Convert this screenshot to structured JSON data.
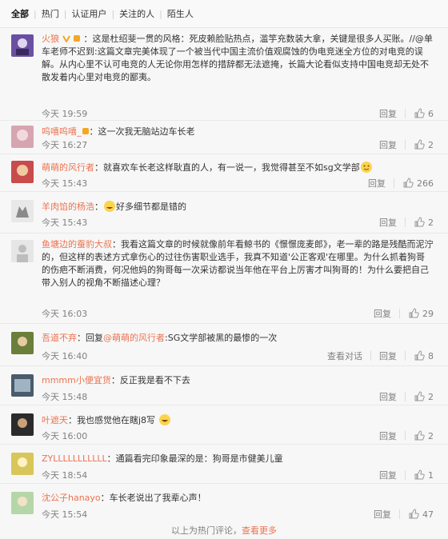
{
  "tabs": [
    "全部",
    "热门",
    "认证用户",
    "关注的人",
    "陌生人"
  ],
  "comments": [
    {
      "name": "火狼",
      "sep": "：",
      "text": "这是杜绍斐一贯的风格：死皮赖脸贴热点，滥竽充数装大拿，关键是很多人买账。//@单车老师不迟到:这篇文章完美体现了一个被当代中国主流价值观腐蚀的伪电竞迷全方位的对电竞的误解。从内心里不认可电竞的人无论你用怎样的措辞都无法遮掩，长篇大论看似支持中国电竞却无处不散发着内心里对电竞的鄙夷。",
      "time": "今天 19:59",
      "reply": "回复",
      "likes": "6"
    },
    {
      "name": "呜嘻呜嘻_",
      "sep": "：",
      "text": "这一次我无脑站边车长老",
      "time": "今天 16:27",
      "reply": "回复",
      "likes": "2"
    },
    {
      "name": "萌萌的风行者",
      "sep": "：",
      "text": "就喜欢车长老这样耿直的人，有一说一，我觉得甚至不如sg文学部",
      "time": "今天 15:43",
      "reply": "回复",
      "likes": "266"
    },
    {
      "name": "羊肉馅的杨浩",
      "sep": "：",
      "text": "好多细节都是错的",
      "time": "今天 15:43",
      "reply": "回复",
      "likes": "2"
    },
    {
      "name": "鱼塘边的蚕豹大叔",
      "sep": "：",
      "text": "我看这篇文章的时候就像前年看鲸书的《憬憬庞麦郎》，老一辈的路是残酷而泥泞的，但这样的表述方式拿伤心的过往伤害职业选手，我真不知道'公正客观'在哪里。为什么抓着狗哥的伤疤不断消费，何况他妈的狗哥每一次采访都说当年他在平台上厉害才叫狗哥的！为什么要把自己带入别人的视角不断描述心理？",
      "time": "今天 16:03",
      "reply": "回复",
      "likes": "29"
    },
    {
      "name": "吾道不弃",
      "sep": "：",
      "text_pre": "回复",
      "mention": "@萌萌的风行者",
      "text": ":SG文学部被黑的最惨的一次",
      "time": "今天 16:40",
      "view": "查看对话",
      "reply": "回复",
      "likes": "8"
    },
    {
      "name": "mmmm小便宜货",
      "sep": "：",
      "text": "反正我是看不下去",
      "time": "今天 15:48",
      "reply": "回复",
      "likes": "2"
    },
    {
      "name": "叶遮天",
      "sep": "：",
      "text": "我也感觉他在瞎j8写",
      "time": "今天 16:00",
      "reply": "回复",
      "likes": "2"
    },
    {
      "name": "ZYLLLLLLLLLLL",
      "sep": "：",
      "text": "通篇看完印象最深的是：狗哥是市健美儿童",
      "time": "今天 18:54",
      "reply": "回复",
      "likes": "1"
    },
    {
      "name": "沈公子hanayo",
      "sep": "：",
      "text": "车长老说出了我辈心声！",
      "time": "今天 15:54",
      "reply": "回复",
      "likes": "47"
    }
  ],
  "footer": {
    "text": "以上为热门评论，",
    "more": "查看更多"
  },
  "colors": {
    "accent": "#eb7350",
    "meta": "#808080"
  }
}
